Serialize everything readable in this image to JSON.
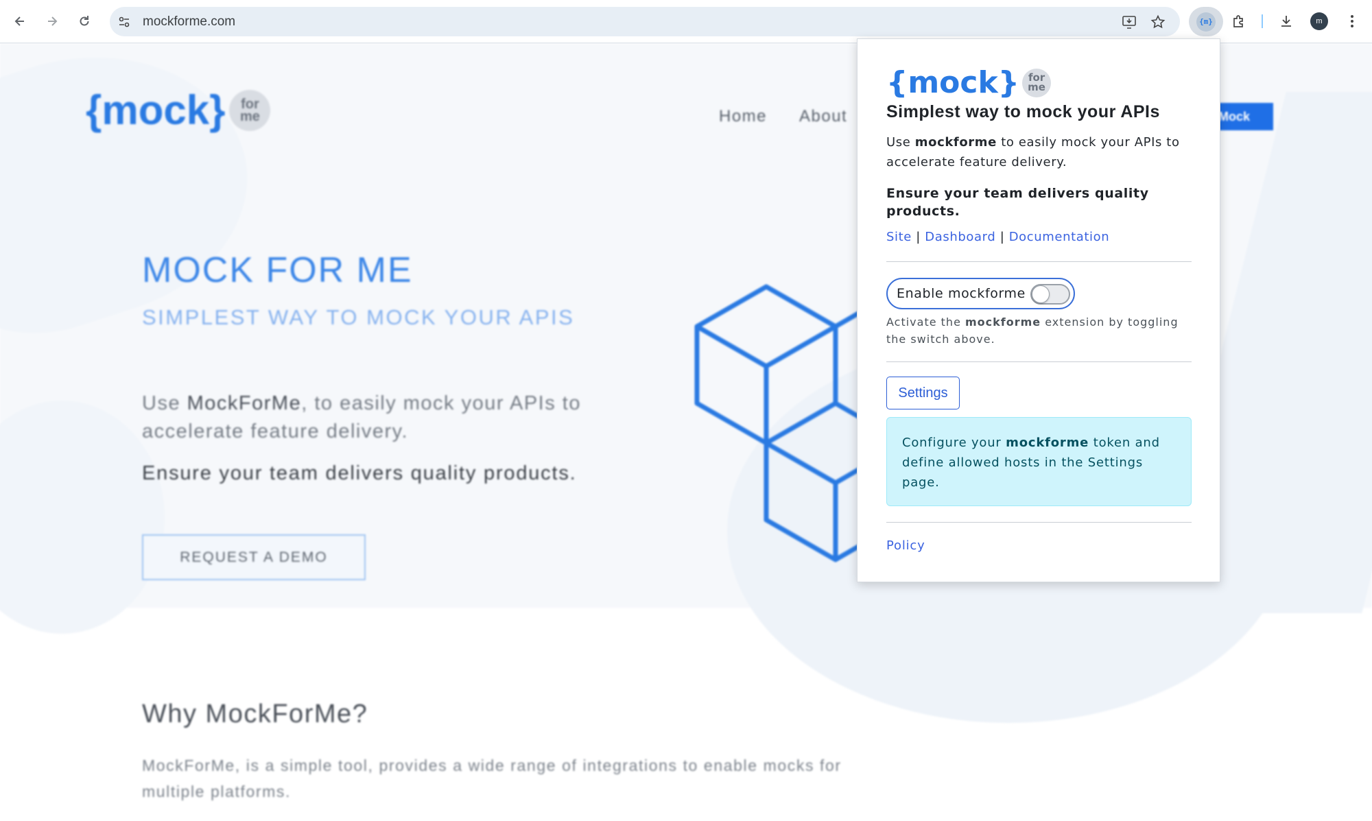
{
  "browser": {
    "url": "mockforme.com",
    "extension_chip": "{m}",
    "profile_initial": "m"
  },
  "site": {
    "logo_main": "{mock}",
    "logo_for_top": "for",
    "logo_for_bottom": "me",
    "nav": [
      "Home",
      "About"
    ],
    "nav_button": "Mock",
    "hero_title": "MOCK FOR ME",
    "hero_subtitle": "SIMPLEST WAY TO MOCK YOUR APIS",
    "hero_desc_prefix": "Use ",
    "hero_desc_brand": "MockForMe",
    "hero_desc_suffix": ", to easily mock your APIs to accelerate feature delivery.",
    "hero_quality": "Ensure your team delivers quality products.",
    "demo_button": "REQUEST A DEMO",
    "why_title": "Why MockForMe?",
    "why_desc": "MockForMe, is a simple tool, provides a wide range of integrations to enable mocks for multiple platforms."
  },
  "popup": {
    "logo_main": "{mock}",
    "logo_for_top": "for",
    "logo_for_bottom": "me",
    "title": "Simplest way to mock your APIs",
    "desc_prefix": "Use ",
    "desc_brand": "mockforme",
    "desc_suffix": " to easily mock your APIs to accelerate feature delivery.",
    "quality": "Ensure your team delivers quality products.",
    "links": {
      "site": "Site",
      "dashboard": "Dashboard",
      "documentation": "Documentation",
      "separator": "|"
    },
    "toggle_label": "Enable mockforme",
    "toggle_on": false,
    "note_prefix": "Activate the ",
    "note_brand": "mockforme",
    "note_suffix": " extension by toggling the switch above.",
    "settings_button": "Settings",
    "info_prefix": "Configure your ",
    "info_brand": "mockforme",
    "info_suffix": " token and define allowed hosts in the Settings page.",
    "policy": "Policy"
  },
  "colors": {
    "brand_blue": "#2a7ae2",
    "link_blue": "#3b63e0",
    "info_bg": "#cff4fc"
  },
  "icons": [
    "back-icon",
    "forward-icon",
    "reload-icon",
    "site-info-icon",
    "install-app-icon",
    "star-icon",
    "extensions-icon",
    "download-icon",
    "kebab-menu-icon"
  ]
}
